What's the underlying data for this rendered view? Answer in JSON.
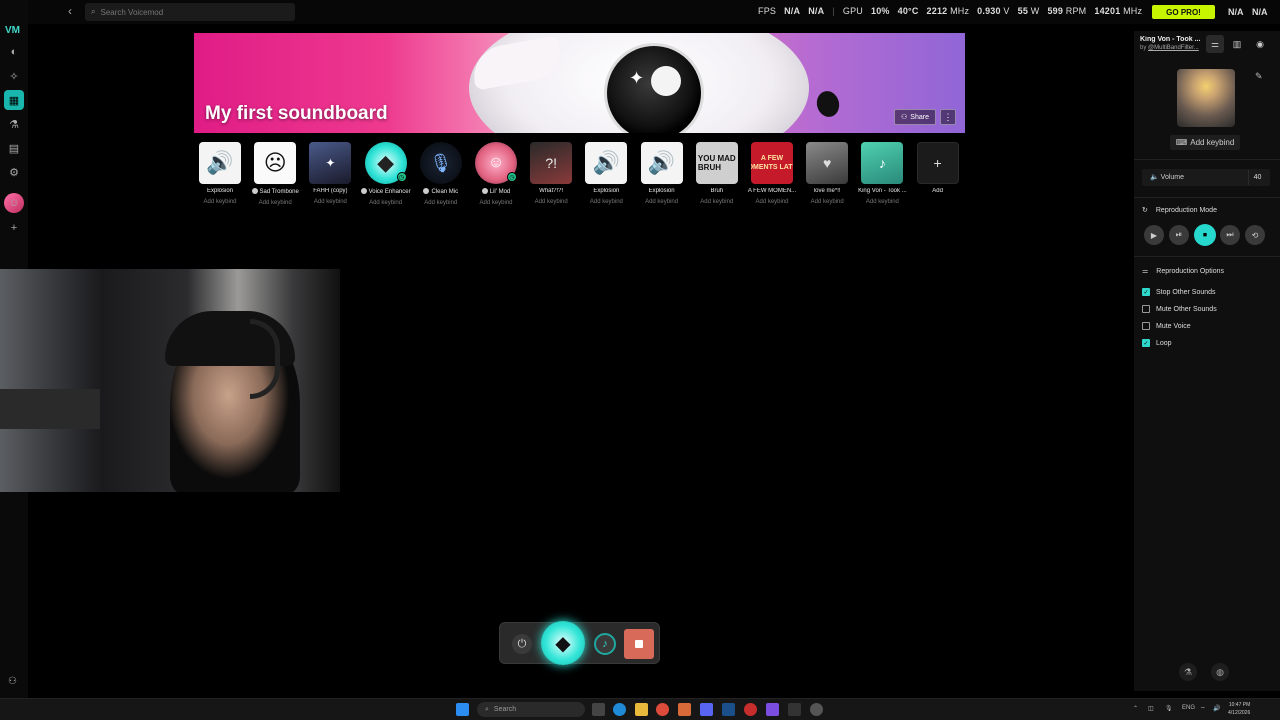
{
  "topbar": {
    "search_placeholder": "Search Voicemod",
    "stats": {
      "fps_label": "FPS",
      "fps_value": "N/A",
      "fps_value2": "N/A",
      "gpu_label": "GPU",
      "gpu_usage": "10%",
      "gpu_temp": "40°C",
      "gpu_clock": "2212",
      "gpu_clock_unit": "MHz",
      "gpu_voltage": "0.930",
      "gpu_voltage_unit": "V",
      "gpu_power": "55",
      "gpu_power_unit": "W",
      "fan": "599",
      "fan_unit": "RPM",
      "mem_clock": "14201",
      "mem_clock_unit": "MHz"
    },
    "go_pro": "GO PRO!",
    "right_na1": "N/A",
    "right_na2": "N/A"
  },
  "banner": {
    "title": "My first soundboard",
    "share_label": "Share",
    "more_label": "⋮"
  },
  "sounds": [
    {
      "name": "Explosion",
      "keybind": "Add keybind",
      "icon": "speaker-icon",
      "glyph": "🔊"
    },
    {
      "name": "Sad Trombone",
      "keybind": "Add keybind",
      "icon": "sad-face-icon",
      "glyph": "☹",
      "dot": true
    },
    {
      "name": "FAHH (copy)",
      "keybind": "Add keybind",
      "icon": "vegeta-image",
      "glyph": "✦"
    },
    {
      "name": "Voice Enhancer",
      "keybind": "Add keybind",
      "icon": "diamond-icon",
      "glyph": "◆",
      "dot": true
    },
    {
      "name": "Clean Mic",
      "keybind": "Add keybind",
      "icon": "microphone-icon",
      "glyph": "🎙",
      "dot": true
    },
    {
      "name": "Lil' Mod",
      "keybind": "Add keybind",
      "icon": "lil-mod-avatar",
      "glyph": "☺",
      "dot": true
    },
    {
      "name": "What?!?!",
      "keybind": "Add keybind",
      "icon": "what-image",
      "glyph": "?!"
    },
    {
      "name": "Explosion",
      "keybind": "Add keybind",
      "icon": "speaker-icon",
      "glyph": "🔊"
    },
    {
      "name": "Explosion",
      "keybind": "Add keybind",
      "icon": "speaker-icon",
      "glyph": "🔊"
    },
    {
      "name": "Bruh",
      "keybind": "Add keybind",
      "icon": "bruh-image",
      "glyph": "YOU MAD\nBRUH"
    },
    {
      "name": "A FEW MOMEN...",
      "keybind": "Add keybind",
      "icon": "few-moments-image",
      "glyph": "A FEW\nMOMENTS LATER"
    },
    {
      "name": "love me*!!",
      "keybind": "Add keybind",
      "icon": "love-image",
      "glyph": "♥"
    },
    {
      "name": "King Von - Took ...",
      "keybind": "Add keybind",
      "icon": "king-von-image",
      "glyph": "♪"
    }
  ],
  "add_tile": {
    "name": "Add",
    "glyph": "+"
  },
  "panel": {
    "title": "King Von - Took ...",
    "by": "by",
    "author": "@MultiBandFilter...",
    "add_keybind": "Add keybind",
    "volume_label": "Volume",
    "volume_value": "40",
    "reproduction_mode": "Reproduction Mode",
    "reproduction_options": "Reproduction Options",
    "options": [
      {
        "label": "Stop Other Sounds",
        "checked": true
      },
      {
        "label": "Mute Other Sounds",
        "checked": false
      },
      {
        "label": "Mute Voice",
        "checked": false
      },
      {
        "label": "Loop",
        "checked": true
      }
    ]
  },
  "taskbar": {
    "search_placeholder": "Search",
    "lang": "ENG",
    "time": "10:47 PM",
    "date": "4/12/2026"
  },
  "colors": {
    "accent": "#27d8cc",
    "gopro": "#c7f500",
    "stop": "#d86a5a"
  }
}
